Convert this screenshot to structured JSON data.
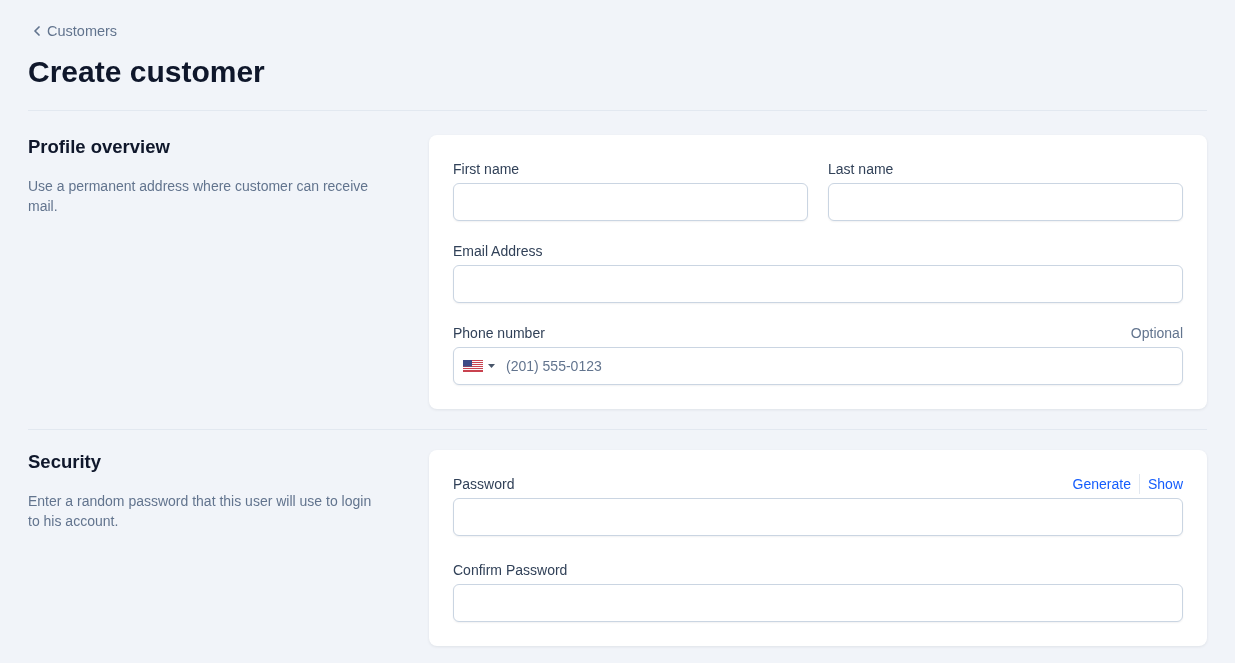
{
  "breadcrumb": {
    "label": "Customers"
  },
  "title": "Create customer",
  "sections": [
    {
      "heading": "Profile overview",
      "description": "Use a permanent address where customer can receive mail.",
      "rows": [
        [
          {
            "kind": "text",
            "label": "First name"
          },
          {
            "kind": "text",
            "label": "Last name"
          }
        ],
        [
          {
            "kind": "text",
            "label": "Email Address"
          }
        ],
        [
          {
            "kind": "phone",
            "label": "Phone number",
            "hint": "Optional",
            "placeholder": "(201) 555-0123"
          }
        ]
      ]
    },
    {
      "heading": "Security",
      "description": "Enter a random password that this user will use to login to his account.",
      "rows": [
        [
          {
            "kind": "password",
            "label": "Password",
            "links": [
              "Generate",
              "Show"
            ]
          }
        ],
        [
          {
            "kind": "password",
            "label": "Confirm Password"
          }
        ]
      ]
    }
  ]
}
